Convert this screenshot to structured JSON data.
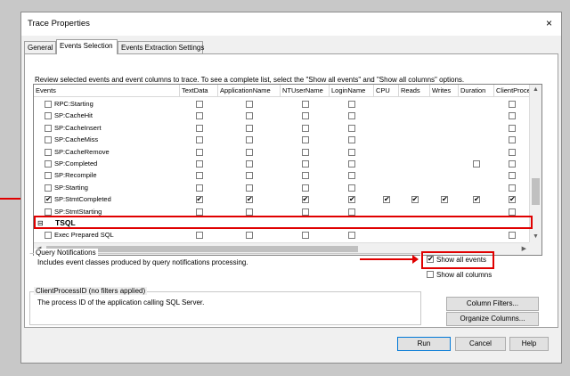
{
  "window": {
    "title": "Trace Properties",
    "close_icon": "×"
  },
  "tabs": [
    {
      "label": "General",
      "active": false
    },
    {
      "label": "Events Selection",
      "active": true
    },
    {
      "label": "Events Extraction Settings",
      "active": false
    }
  ],
  "description": "Review selected events and event columns to trace. To see a complete list, select the \"Show all events\" and \"Show all columns\" options.",
  "grid": {
    "columns": [
      "Events",
      "TextData",
      "ApplicationName",
      "NTUserName",
      "LoginName",
      "CPU",
      "Reads",
      "Writes",
      "Duration",
      "ClientProcessID"
    ],
    "rows": [
      {
        "type": "event",
        "name": "RPC:Starting",
        "checked": false,
        "cells": [
          0,
          0,
          0,
          0,
          null,
          null,
          null,
          null,
          0
        ]
      },
      {
        "type": "event",
        "name": "SP:CacheHit",
        "checked": false,
        "cells": [
          0,
          0,
          0,
          0,
          null,
          null,
          null,
          null,
          0
        ]
      },
      {
        "type": "event",
        "name": "SP:CacheInsert",
        "checked": false,
        "cells": [
          0,
          0,
          0,
          0,
          null,
          null,
          null,
          null,
          0
        ]
      },
      {
        "type": "event",
        "name": "SP:CacheMiss",
        "checked": false,
        "cells": [
          0,
          0,
          0,
          0,
          null,
          null,
          null,
          null,
          0
        ]
      },
      {
        "type": "event",
        "name": "SP:CacheRemove",
        "checked": false,
        "cells": [
          0,
          0,
          0,
          0,
          null,
          null,
          null,
          null,
          0
        ]
      },
      {
        "type": "event",
        "name": "SP:Completed",
        "checked": false,
        "cells": [
          0,
          0,
          0,
          0,
          null,
          null,
          null,
          0,
          0
        ]
      },
      {
        "type": "event",
        "name": "SP:Recompile",
        "checked": false,
        "cells": [
          0,
          0,
          0,
          0,
          null,
          null,
          null,
          null,
          0
        ]
      },
      {
        "type": "event",
        "name": "SP:Starting",
        "checked": false,
        "cells": [
          0,
          0,
          0,
          0,
          null,
          null,
          null,
          null,
          0
        ]
      },
      {
        "type": "event",
        "name": "SP:StmtCompleted",
        "checked": true,
        "cells": [
          1,
          1,
          1,
          1,
          1,
          1,
          1,
          1,
          1
        ]
      },
      {
        "type": "event",
        "name": "SP:StmtStarting",
        "checked": false,
        "cells": [
          0,
          0,
          0,
          0,
          null,
          null,
          null,
          null,
          0
        ]
      },
      {
        "type": "category",
        "name": "TSQL",
        "expander": "⊟"
      },
      {
        "type": "event",
        "name": "Exec Prepared SQL",
        "checked": false,
        "cells": [
          0,
          0,
          0,
          0,
          null,
          null,
          null,
          null,
          0
        ]
      }
    ]
  },
  "query_notifications": {
    "label": "Query Notifications",
    "text": "Includes event classes produced by query notifications processing."
  },
  "client_process": {
    "label": "ClientProcessID (no filters applied)",
    "text": "The process ID of the application calling SQL Server."
  },
  "options": {
    "show_all_events": {
      "label": "Show all events",
      "checked": true
    },
    "show_all_columns": {
      "label": "Show all columns",
      "checked": false
    }
  },
  "buttons": {
    "column_filters": "Column Filters...",
    "organize_columns": "Organize Columns...",
    "run": "Run",
    "cancel": "Cancel",
    "help": "Help"
  },
  "check_mark": "✔",
  "colors": {
    "annotation_red": "#e00000",
    "highlight_border": "#e00000"
  }
}
